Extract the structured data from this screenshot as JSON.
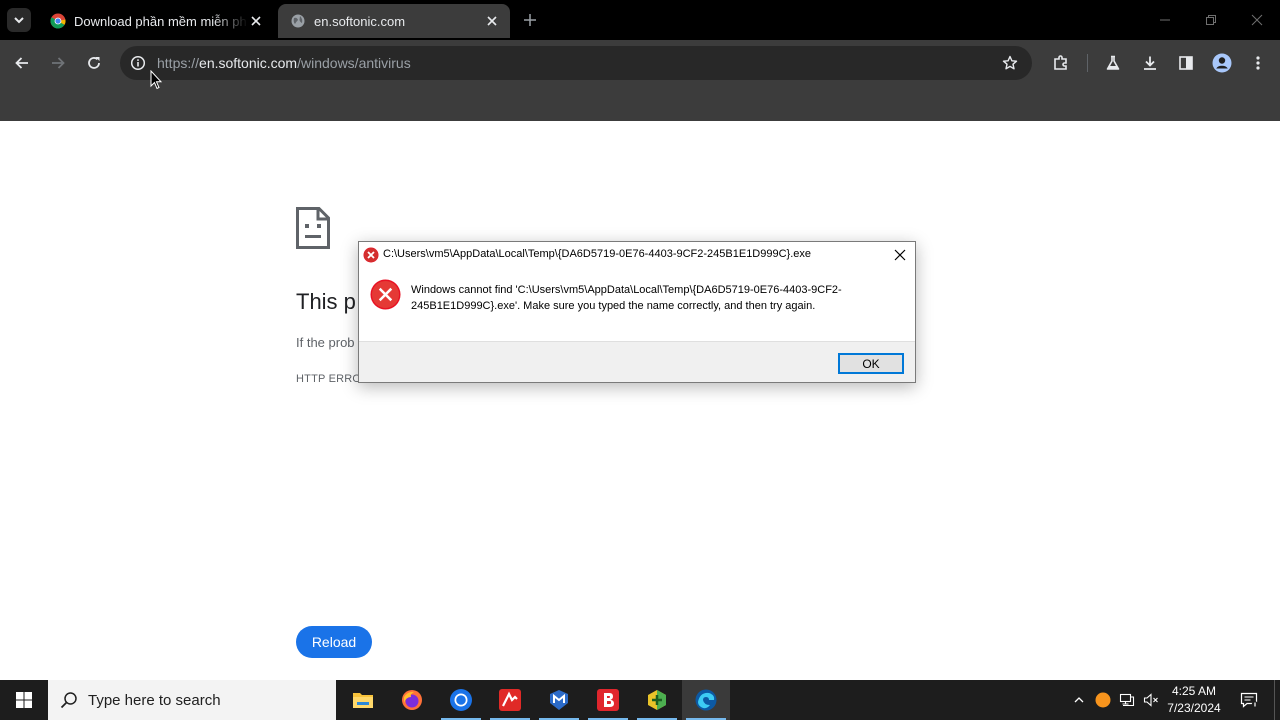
{
  "browser": {
    "tabs": [
      {
        "title": "Download phần mềm miễn phí",
        "active": false
      },
      {
        "title": "en.softonic.com",
        "active": true
      }
    ],
    "url": {
      "scheme": "https://",
      "host": "en.softonic.com",
      "path": "/windows/antivirus"
    }
  },
  "page": {
    "heading": "This p",
    "suggestion": "If the prob",
    "error_code": "HTTP ERRO",
    "reload_label": "Reload"
  },
  "dialog": {
    "title": "C:\\Users\\vm5\\AppData\\Local\\Temp\\{DA6D5719-0E76-4403-9CF2-245B1E1D999C}.exe",
    "message": "Windows cannot find 'C:\\Users\\vm5\\AppData\\Local\\Temp\\{DA6D5719-0E76-4403-9CF2-245B1E1D999C}.exe'. Make sure you typed the name correctly, and then try again.",
    "ok_label": "OK"
  },
  "taskbar": {
    "search_placeholder": "Type here to search",
    "apps": [
      "file-explorer-icon",
      "firefox-icon",
      "chrome-icon",
      "avira-icon",
      "malwarebytes-icon",
      "bitdefender-icon",
      "sandboxie-icon",
      "edge-icon"
    ],
    "time": "4:25 AM",
    "date": "7/23/2024"
  },
  "colors": {
    "accent_blue": "#1a73e8",
    "error_red": "#e81123",
    "dialog_focus": "#0078d7"
  }
}
